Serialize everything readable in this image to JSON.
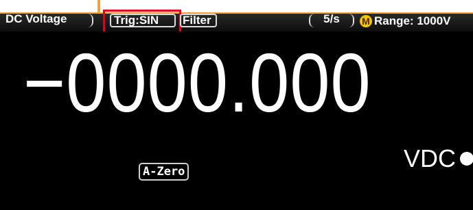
{
  "header": {
    "mode_label": "DC Voltage",
    "trigger_label": "Trig:SIN",
    "filter_label": "Filter",
    "rate_label": "5/s",
    "range_icon": "M",
    "range_label": "Range: 1000V"
  },
  "measurement": {
    "reading": "−0000.000",
    "unit": "VDC"
  },
  "status": {
    "azero_label": "A-Zero"
  },
  "colors": {
    "annotation": "#f2a23a",
    "highlight": "#e3001b",
    "range_icon": "#f5c400",
    "background": "#000000"
  }
}
